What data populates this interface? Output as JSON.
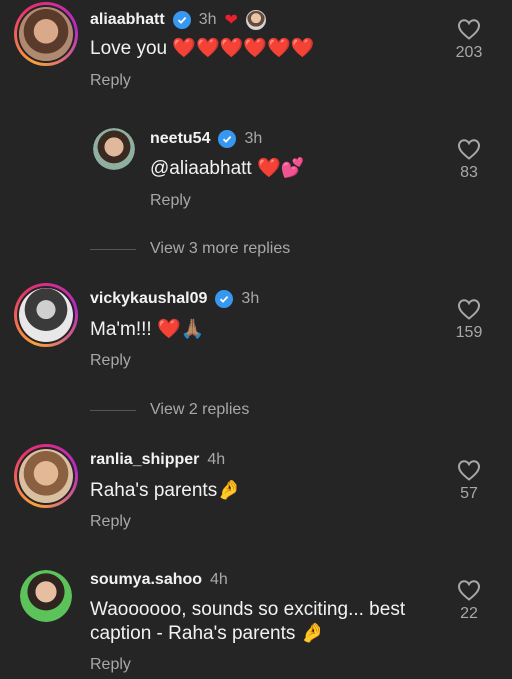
{
  "comments": [
    {
      "username": "aliaabhatt",
      "time": "3h",
      "verified": true,
      "text": "Love you ❤️❤️❤️❤️❤️❤️",
      "reply_label": "Reply",
      "likes": "203"
    },
    {
      "username": "neetu54",
      "time": "3h",
      "verified": true,
      "text": "@aliaabhatt ❤️💕",
      "reply_label": "Reply",
      "likes": "83"
    },
    {
      "username": "vickykaushal09",
      "time": "3h",
      "verified": true,
      "text": "Ma'm!!! ❤️🙏🏽",
      "reply_label": "Reply",
      "likes": "159"
    },
    {
      "username": "ranlia_shipper",
      "time": "4h",
      "verified": false,
      "text": "Raha's parents🤌",
      "reply_label": "Reply",
      "likes": "57"
    },
    {
      "username": "soumya.sahoo",
      "time": "4h",
      "verified": false,
      "text_line1": "Waoooooo, sounds so exciting... best",
      "text_line2": "caption - Raha's parents 🤌",
      "reply_label": "Reply",
      "likes": "22"
    }
  ],
  "view_replies": [
    {
      "label": "View 3 more replies"
    },
    {
      "label": "View 2 replies"
    }
  ],
  "colors": {
    "background": "#252525",
    "text": "#f2f2f2",
    "muted": "#a8a8a8",
    "verified": "#3897f0",
    "heart": "#e8222e"
  }
}
